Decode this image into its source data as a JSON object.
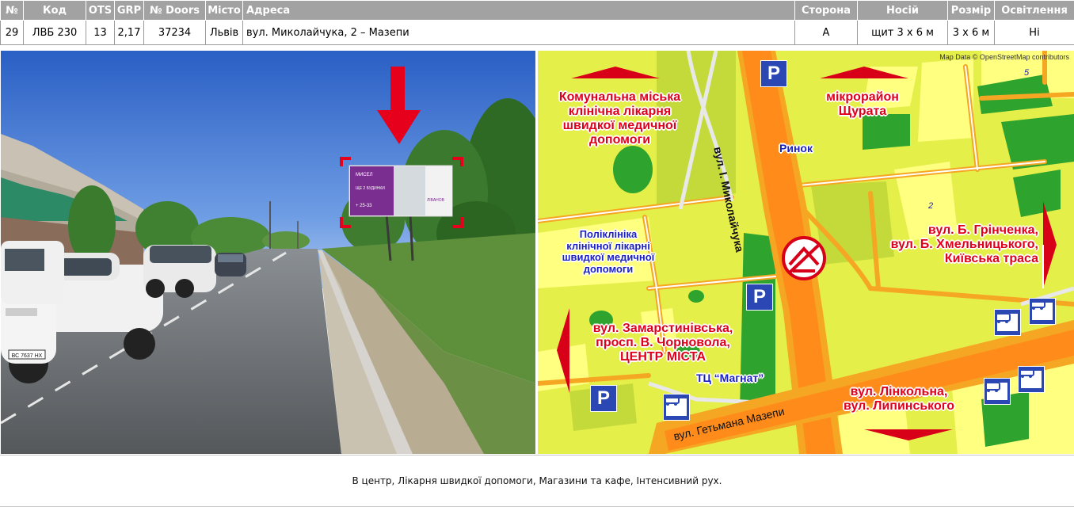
{
  "table": {
    "headers": [
      "№",
      "Код",
      "OTS",
      "GRP",
      "№ Doors",
      "Місто",
      "Адреса",
      "Сторона",
      "Носій",
      "Розмір",
      "Освітлення"
    ],
    "row": [
      "29",
      "ЛВБ 230",
      "13",
      "2,17",
      "37234",
      "Львів",
      "вул. Миколайчука, 2 – Мазепи",
      "A",
      "щит 3 х 6 м",
      "3 х 6 м",
      "Ні"
    ]
  },
  "photo": {
    "billboard_text": [
      "МИСЕЛ",
      "ЩЕ 2 БУДИНКИ",
      "ЛІВАНОВ",
      "+ 25-33"
    ],
    "plate_text": "ВС 7637 НХ"
  },
  "map": {
    "credit": "Map Data © OpenStreetMap contributors",
    "labels": {
      "hospital": "Комунальна міська\nклінічна лікарня\nшвидкої медичної\nдопомоги",
      "district": "мікрорайон\nЩурата",
      "market": "Ринок",
      "polyclinic": "Поліклініка\nклінічної лікарні\nшвидкої медичної\nдопомоги",
      "east_dir": "вул. Б. Грінченка,\nвул. Б. Хмельницького,\nКиївська траса",
      "west_dir": "вул. Замарстинівська,\nпросп. В. Чорновола,\nЦЕНТР МІСТА",
      "mall": "ТЦ “Магнат”",
      "south_dir": "вул. Лінкольна,\nвул. Липинського",
      "street_v": "вул. І. Миколайчука",
      "street_h": "вул. Гетьмана Мазепи",
      "num_5": "5",
      "num_2": "2"
    },
    "parking_label": "P",
    "colors": {
      "background": "#e5ef4a",
      "major_road": "#f5a623",
      "green": "#2ea32e",
      "building": "#ffff80",
      "arrow": "#d80018",
      "sign": "#2a47b3"
    }
  },
  "footer": "В центр, Лікарня швидкої допомоги, Магазини та кафе, Інтенсивний рух."
}
